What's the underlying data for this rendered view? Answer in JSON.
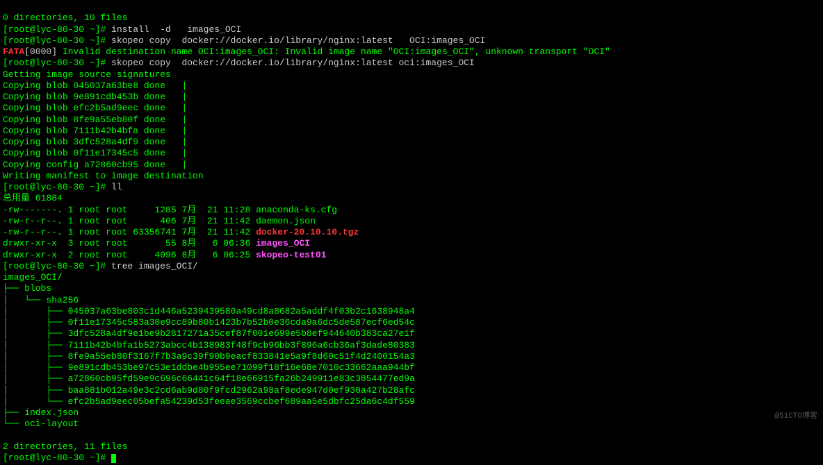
{
  "prompt_prefix": "[root@lyc-80-30 ~]# ",
  "lines": {
    "l0": "0 directories, 10 files",
    "cmd1": "install  -d   images_OCI",
    "cmd2": "skopeo copy  docker://docker.io/library/nginx:latest   OCI:images_OCI",
    "fata_label": "FATA",
    "fata_ts": "[0000]",
    "fata_msg": " Invalid destination name OCI:images_OCI: Invalid image name \"OCI:images_OCI\", unknown transport \"OCI\"",
    "cmd3": "skopeo copy  docker://docker.io/library/nginx:latest oci:images_OCI",
    "sig": "Getting image source signatures",
    "blob1": "Copying blob 045037a63be8 done   |",
    "blob2": "Copying blob 9e891cdb453b done   |",
    "blob3": "Copying blob efc2b5ad9eec done   |",
    "blob4": "Copying blob 8fe9a55eb80f done   |",
    "blob5": "Copying blob 7111b42b4bfa done   |",
    "blob6": "Copying blob 3dfc528a4df9 done   |",
    "blob7": "Copying blob 0f11e17345c5 done   |",
    "cfg": "Copying config a72860cb95 done   |",
    "manifest": "Writing manifest to image destination",
    "cmd4": "ll",
    "total": "总用量 61884",
    "ls1a": "-rw-------. 1 root root     1285 7月  21 11:28 ",
    "ls1b": "anaconda-ks.cfg",
    "ls2a": "-rw-r--r--. 1 root root      406 7月  21 11:42 ",
    "ls2b": "daemon.json",
    "ls3a": "-rw-r--r--. 1 root root 63356741 7月  21 11:42 ",
    "ls3b": "docker-20.10.10.tgz",
    "ls4a": "drwxr-xr-x  3 root root       55 8月   6 06:36 ",
    "ls4b": "images_OCI",
    "ls5a": "drwxr-xr-x  2 root root     4096 8月   6 06:25 ",
    "ls5b": "skopeo-test01",
    "cmd5": "tree images_OCI/",
    "t_root": "images_OCI/",
    "t_blobs": "├── blobs",
    "t_sha": "│   └── sha256",
    "t_h1": "│       ├── 045037a63be803c1d446a5239439580a49cd8a8682a5addf4f03b2c1638948a4",
    "t_h2": "│       ├── 0f11e17345c583a30e9cc89b80b1423b7b52b0e36cda9a6dc5de587ecf6ed54c",
    "t_h3": "│       ├── 3dfc528a4df9e1be9b2817271a35cef87f001e699e5b8ef944640b383ca27e1f",
    "t_h4": "│       ├── 7111b42b4bfa1b5273abcc4b138983f48f9cb96bb3f896a6cb36af3dade80383",
    "t_h5": "│       ├── 8fe9a55eb80f3167f7b3a9c39f90b9eacf833841e5a9f8d60c51f4d2400154a3",
    "t_h6": "│       ├── 9e891cdb453be97c53e1ddbe4b955ee71099f18f16e68e7010c33662aaa944bf",
    "t_h7": "│       ├── a72860cb95fd59e9c696c66441c64f18e66915fa26b249911e83c3854477ed9a",
    "t_h8": "│       ├── baa881b012a49e3c2cd6ab9d80f9fcd2962a98af8ede947d0ef930a427b28afc",
    "t_h9": "│       └── efc2b5ad9eec05befa54239d53feeae3569ccbef689aa5e5dbfc25da6c4df559",
    "t_idx": "├── index.json",
    "t_oci": "└── oci-layout",
    "summary": "2 directories, 11 files",
    "watermark": "@51CTO博客"
  }
}
